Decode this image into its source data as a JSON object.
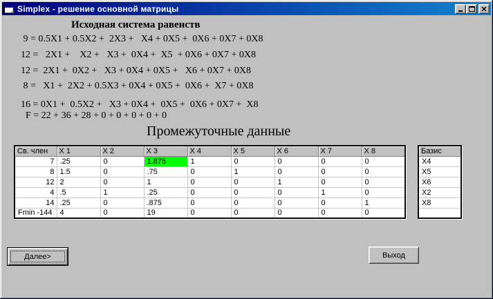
{
  "window": {
    "title": "Simplex - решение основной матрицы"
  },
  "icons": {
    "form": "vb-form-window",
    "minimize": "_",
    "maximize": "□",
    "close": "✕"
  },
  "colors": {
    "titlebar_left": "#000080",
    "titlebar_right": "#1084d0",
    "client_bg": "#c0c0c0",
    "highlight_green": "#00ff00"
  },
  "equations": {
    "heading": "Исходная система равенств",
    "lines": [
      " 9 = 0.5X1 + 0.5X2 +  2X3 +   X4 + 0X5 +  0X6 + 0X7 + 0X8",
      "12 =   2X1 +    X2 +   X3 +  0X4 +  X5  + 0X6 + 0X7 + 0X8",
      "12 =  2X1 +  0X2 +   X3 + 0X4 + 0X5 +   X6 + 0X7 + 0X8",
      " 8 =   X1 +  2X2 + 0.5X3 + 0X4 + 0X5 +  0X6 +  X7 + 0X8",
      "16 = 0X1 +  0.5X2 +   X3 + 0X4 +  0X5 +  0X6 + 0X7 +  X8",
      "  F = 22 + 36 + 28 + 0 + 0 + 0 + 0 + 0"
    ]
  },
  "intermediate": {
    "heading": "Промежуточные данные",
    "main_grid": {
      "columns": [
        "Св. член",
        "X 1",
        "X 2",
        "X 3",
        "X 4",
        "X 5",
        "X 6",
        "X 7",
        "X 8"
      ],
      "rows": [
        [
          "7",
          ".25",
          "0",
          "1.875",
          "1",
          "0",
          "0",
          "0",
          "0"
        ],
        [
          "8",
          "1.5",
          "0",
          ".75",
          "0",
          "1",
          "0",
          "0",
          "0"
        ],
        [
          "12",
          "2",
          "0",
          "1",
          "0",
          "0",
          "1",
          "0",
          "0"
        ],
        [
          "4",
          ".5",
          "1",
          ".25",
          "0",
          "0",
          "0",
          "1",
          "0"
        ],
        [
          "14",
          ".25",
          "0",
          ".875",
          "0",
          "0",
          "0",
          "0",
          "1"
        ],
        [
          "Fmin -144",
          "4",
          "0",
          "19",
          "0",
          "0",
          "0",
          "0",
          "0"
        ]
      ],
      "highlight": {
        "row": 0,
        "col": 3,
        "color": "#00ff00"
      }
    },
    "basis_grid": {
      "columns": [
        "Базис"
      ],
      "rows": [
        [
          "X4"
        ],
        [
          "X5"
        ],
        [
          "X6"
        ],
        [
          "X2"
        ],
        [
          "X8"
        ],
        [
          ""
        ]
      ]
    }
  },
  "buttons": {
    "next": "Далее>",
    "exit": "Выход"
  }
}
